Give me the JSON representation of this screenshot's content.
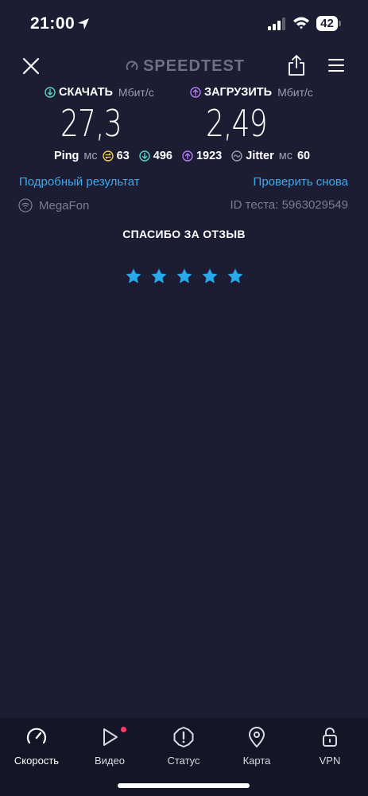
{
  "status_bar": {
    "time": "21:00",
    "battery": "42"
  },
  "header": {
    "logo": "SPEEDTEST"
  },
  "results": {
    "download": {
      "title": "СКАЧАТЬ",
      "unit": "Мбит/с",
      "value": "27,3"
    },
    "upload": {
      "title": "ЗАГРУЗИТЬ",
      "unit": "Мбит/с",
      "value": "2,49"
    }
  },
  "ping": {
    "label": "Ping",
    "unit": "мс",
    "idle": "63",
    "download": "496",
    "upload": "1923",
    "jitter_label": "Jitter",
    "jitter_unit": "мс",
    "jitter": "60"
  },
  "links": {
    "details": "Подробный результат",
    "retest": "Проверить снова"
  },
  "info": {
    "provider": "MegaFon",
    "test_id": "ID теста: 5963029549"
  },
  "feedback": {
    "thanks": "СПАСИБО ЗА ОТЗЫВ",
    "rating": 5,
    "max_rating": 5
  },
  "colors": {
    "background": "#1c1d33",
    "download_accent": "#59d2c8",
    "upload_accent": "#b57cf7",
    "link": "#3ea9ec",
    "star": "#2aa8ee"
  },
  "nav": {
    "items": [
      {
        "label": "Скорость",
        "icon": "speedometer-icon",
        "active": true
      },
      {
        "label": "Видео",
        "icon": "play-icon",
        "badge": true
      },
      {
        "label": "Статус",
        "icon": "alert-icon"
      },
      {
        "label": "Карта",
        "icon": "map-pin-icon"
      },
      {
        "label": "VPN",
        "icon": "lock-icon"
      }
    ]
  }
}
